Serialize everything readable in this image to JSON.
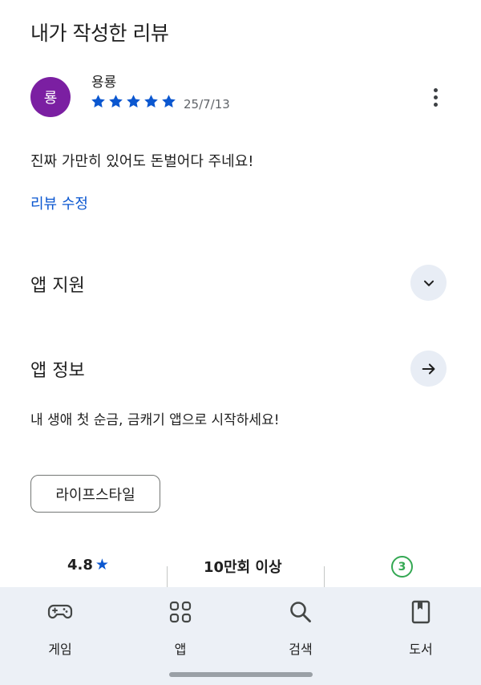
{
  "section": {
    "title": "내가 작성한 리뷰"
  },
  "review": {
    "avatar_initial": "룡",
    "avatar_color": "#7b1fa2",
    "reviewer_name": "용룡",
    "rating": 5,
    "date": "25/7/13",
    "text": "진짜 가만히 있어도 돈벌어다 주네요!",
    "edit_label": "리뷰 수정"
  },
  "support": {
    "title": "앱 지원",
    "icon": "chevron-down-icon"
  },
  "app_info": {
    "title": "앱 정보",
    "icon": "arrow-right-icon",
    "description": "내 생애 첫 순금, 금캐기 앱으로 시작하세요!",
    "category_chip": "라이프스타일"
  },
  "stats": {
    "rating": "4.8",
    "downloads": "10만회 이상",
    "age_rating": "3"
  },
  "bottom_nav": [
    {
      "label": "게임",
      "icon": "gamepad-icon"
    },
    {
      "label": "앱",
      "icon": "apps-grid-icon"
    },
    {
      "label": "검색",
      "icon": "search-icon"
    },
    {
      "label": "도서",
      "icon": "book-icon"
    }
  ],
  "colors": {
    "accent": "#0b57d0",
    "nav_background": "#ecf0f6",
    "age_badge": "#34a853"
  }
}
